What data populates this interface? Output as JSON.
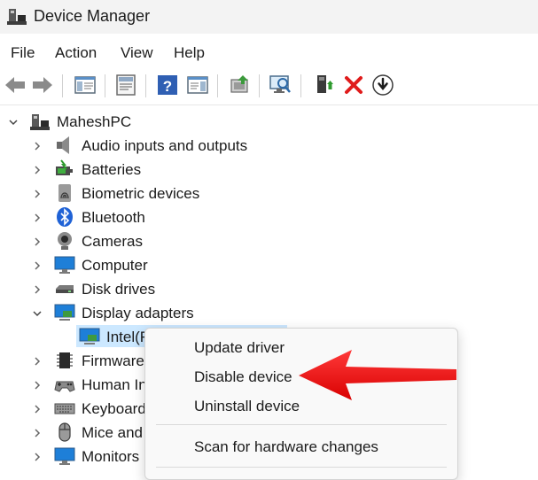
{
  "window": {
    "title": "Device Manager"
  },
  "menu": {
    "items": [
      "File",
      "Action",
      "View",
      "Help"
    ]
  },
  "toolbar": {
    "buttons": [
      "back-arrow",
      "forward-arrow",
      "console-tree",
      "properties",
      "help",
      "action-pane",
      "update-driver",
      "scan-hardware",
      "enable-device",
      "uninstall-device",
      "disable-device"
    ]
  },
  "tree": {
    "root": "MaheshPC",
    "categories": [
      "Audio inputs and outputs",
      "Batteries",
      "Biometric devices",
      "Bluetooth",
      "Cameras",
      "Computer",
      "Disk drives",
      "Display adapters",
      "Firmware",
      "Human Interface Devices",
      "Keyboards",
      "Mice and other pointing devices",
      "Monitors"
    ],
    "selected_child": "Intel(R) UHD Graphics"
  },
  "context_menu": {
    "items": [
      "Update driver",
      "Disable device",
      "Uninstall device",
      "Scan for hardware changes"
    ]
  },
  "colors": {
    "selection": "#cce8ff",
    "annotation_arrow": "#ee1111"
  }
}
